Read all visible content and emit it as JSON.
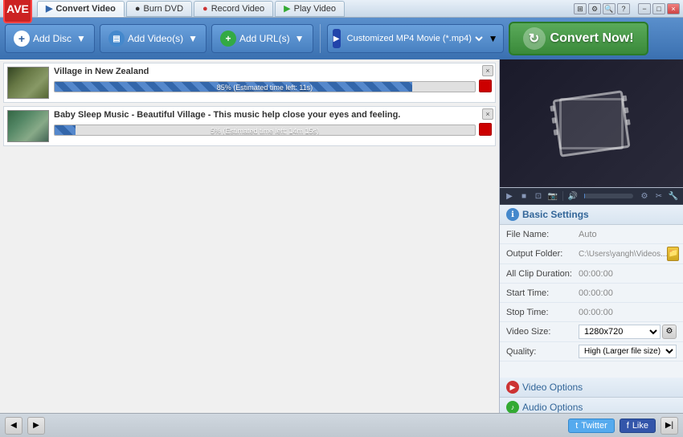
{
  "app": {
    "logo": "AVE",
    "title": "Convert Video"
  },
  "tabs": [
    {
      "id": "convert",
      "label": "Convert Video",
      "icon": "▶",
      "active": true
    },
    {
      "id": "burn",
      "label": "Burn DVD",
      "icon": "💿",
      "active": false
    },
    {
      "id": "record",
      "label": "Record Video",
      "icon": "📹",
      "active": false
    },
    {
      "id": "play",
      "label": "Play Video",
      "icon": "▶",
      "active": false
    }
  ],
  "titlebar_controls": [
    "⊞",
    "?",
    "−",
    "□",
    "×"
  ],
  "toolbar": {
    "add_disc_label": "Add Disc",
    "add_videos_label": "Add Video(s)",
    "add_url_label": "Add URL(s)",
    "format_label": "Customized MP4 Movie (*.mp4)",
    "convert_label": "Convert Now!"
  },
  "videos": [
    {
      "id": 1,
      "title": "Village in New Zealand",
      "progress": 85,
      "progress_text": "85% (Estimated time left: 11s)"
    },
    {
      "id": 2,
      "title": "Baby Sleep Music - Beautiful Village - This music help close your eyes and feeling.",
      "progress": 5,
      "progress_text": "5% (Estimated time left: 14m 15s)"
    }
  ],
  "preview": {
    "progress": 2
  },
  "basic_settings": {
    "header": "Basic Settings",
    "file_name_label": "File Name:",
    "file_name_value": "Auto",
    "output_folder_label": "Output Folder:",
    "output_folder_value": "C:\\Users\\yangh\\Videos...",
    "all_clip_duration_label": "All Clip Duration:",
    "all_clip_duration_value": "00:00:00",
    "start_time_label": "Start Time:",
    "start_time_value": "00:00:00",
    "stop_time_label": "Stop Time:",
    "stop_time_value": "00:00:00",
    "video_size_label": "Video Size:",
    "video_size_value": "1280x720",
    "quality_label": "Quality:",
    "quality_value": "High (Larger file size)"
  },
  "video_options": {
    "label": "Video Options"
  },
  "audio_options": {
    "label": "Audio Options"
  },
  "status_bar": {
    "twitter_label": "t",
    "twitter_text": "Twitter",
    "facebook_label": "f",
    "facebook_text": "Like"
  }
}
